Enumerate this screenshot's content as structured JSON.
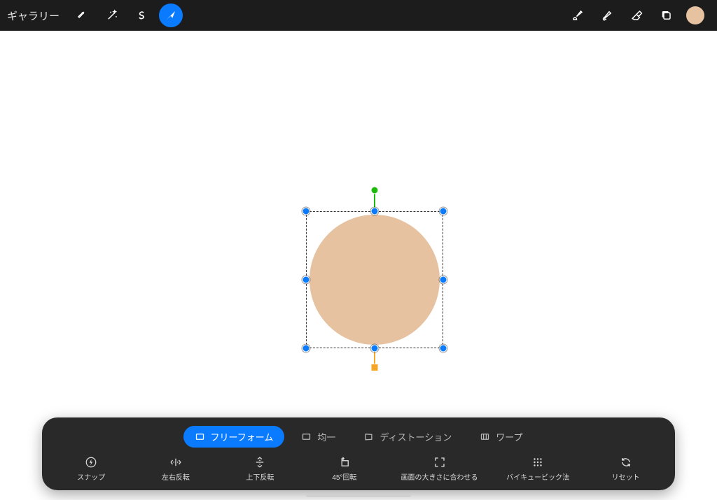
{
  "topbar": {
    "gallery_label": "ギャラリー",
    "icons_left": [
      "wrench-icon",
      "wand-icon",
      "select-s-icon",
      "transform-arrow-icon"
    ],
    "active_left_index": 3,
    "icons_right": [
      "brush-icon",
      "eyedropper-icon",
      "eraser-icon",
      "layers-icon",
      "color-swatch"
    ],
    "swatch_color": "#e6c2a1"
  },
  "canvas": {
    "shape_fill": "#e6c2a1",
    "rotate_handle_color": "#1db90b",
    "selection_handle_color": "#0a7bff",
    "anchor_handle_color": "#f5a623"
  },
  "modes": {
    "items": [
      {
        "label": "フリーフォーム",
        "icon": "rect-icon",
        "active": true
      },
      {
        "label": "均一",
        "icon": "rect-icon",
        "active": false
      },
      {
        "label": "ディストーション",
        "icon": "rect-icon",
        "active": false
      },
      {
        "label": "ワープ",
        "icon": "rect-icon",
        "active": false
      }
    ]
  },
  "actions": {
    "items": [
      {
        "label": "スナップ",
        "icon": "bolt-icon"
      },
      {
        "label": "左右反転",
        "icon": "flip-h-icon"
      },
      {
        "label": "上下反転",
        "icon": "flip-v-icon"
      },
      {
        "label": "45°回転",
        "icon": "rotate-45-icon"
      },
      {
        "label": "画面の大きさに合わせる",
        "icon": "fit-icon"
      },
      {
        "label": "バイキュービック法",
        "icon": "grid-dots-icon"
      },
      {
        "label": "リセット",
        "icon": "reset-icon"
      }
    ]
  }
}
